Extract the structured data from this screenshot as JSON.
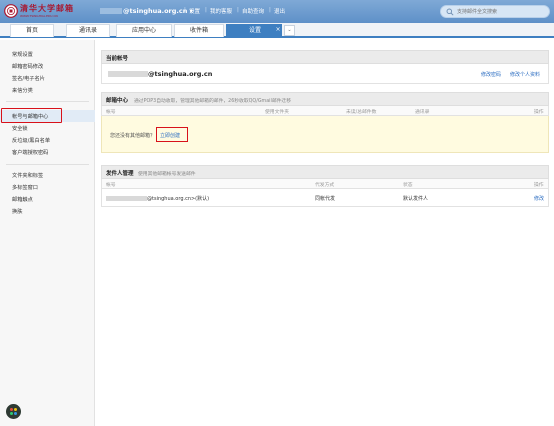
{
  "header": {
    "logo_cn": "清华大学邮箱",
    "logo_en": "WWW.TSINGHUA.EDU.CN",
    "email": "@tsinghua.org.cn",
    "dropdown_arrow": "▾",
    "nav": [
      "设置",
      "我的客服",
      "自助查询",
      "退出"
    ],
    "search_placeholder": "支持邮件全文搜索"
  },
  "tabs": [
    {
      "label": "首页"
    },
    {
      "label": "通讯录"
    },
    {
      "label": "应用中心"
    },
    {
      "label": "收件箱"
    },
    {
      "label": "设置",
      "active": true
    }
  ],
  "tab_close": "×",
  "tab_more": "⌄",
  "sidebar": {
    "group1": [
      "常规设置",
      "邮箱密码修改",
      "签名/电子名片",
      "来信分类"
    ],
    "group2": [
      "帐号与邮箱中心",
      "安全锁",
      "反垃圾/黑白名单",
      "客户端授权密码"
    ],
    "group3": [
      "文件夹和标签",
      "多标签窗口",
      "邮箱触点",
      "换肤"
    ]
  },
  "current_account": {
    "title": "当前帐号",
    "email": "@tsinghua.org.cn",
    "change_password": "修改密码",
    "edit_profile": "修改个人资料"
  },
  "mail_center": {
    "title": "邮箱中心",
    "desc": "通过POP3自动收取，管理其他邮箱的邮件，26秒收取QQ/Gmail邮件迁移",
    "columns": [
      "帐号",
      "使用文件夹",
      "未读/总邮件数",
      "通讯录",
      "操作"
    ],
    "empty_text": "您还没有其他邮箱？",
    "create_now": "立即创建"
  },
  "sender_mgmt": {
    "title": "发件人管理",
    "desc": "使用其他邮箱帐号发送邮件",
    "columns": [
      "帐号",
      "代发方式",
      "状态",
      "操作"
    ],
    "row": {
      "email": "@tsinghua.org.cn>(默认)",
      "method": "同帐代发",
      "status": "默认发件人",
      "action": "修改"
    }
  },
  "colors": {
    "header_blue": "#5e90c8",
    "tab_active": "#3e7fc1",
    "link_blue": "#2a6cc1",
    "highlight_red": "#d8111a",
    "empty_bg": "#fffbe0"
  }
}
